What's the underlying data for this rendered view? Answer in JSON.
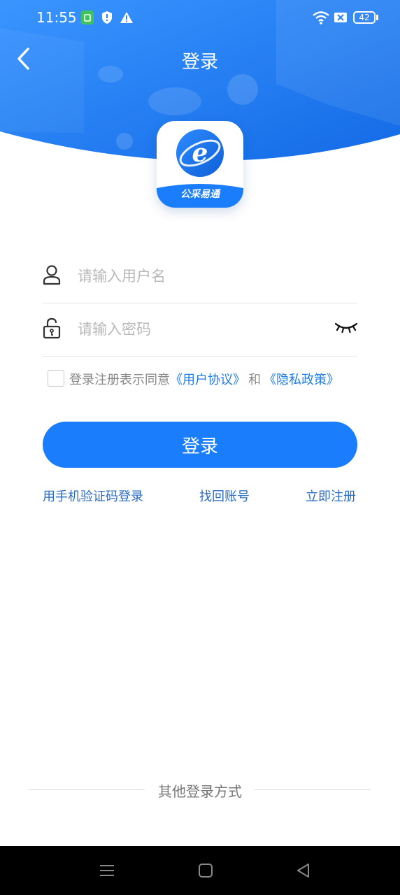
{
  "status_bar": {
    "time": "11:55",
    "battery": "42",
    "icons": [
      "sim-card-icon",
      "shield-icon",
      "warning-icon",
      "wifi-icon",
      "no-sim-icon",
      "battery-icon"
    ]
  },
  "nav": {
    "title": "登录",
    "back_icon": "chevron-left-icon"
  },
  "logo": {
    "text": "公采易通"
  },
  "form": {
    "username_placeholder": "请输入用户名",
    "username_value": "",
    "password_placeholder": "请输入密码",
    "password_value": ""
  },
  "agreement": {
    "prefix": "登录注册表示同意",
    "user_agreement": "《用户协议》",
    "and": "和",
    "privacy_policy": "《隐私政策》",
    "checked": false
  },
  "login_button": "登录",
  "links": {
    "sms_login": "用手机验证码登录",
    "recover_account": "找回账号",
    "register": "立即注册"
  },
  "other_login": "其他登录方式",
  "colors": {
    "primary": "#1a7dfb",
    "link": "#1f7be8",
    "header_gradient_start": "#2f8dff",
    "header_gradient_end": "#1467e8"
  }
}
